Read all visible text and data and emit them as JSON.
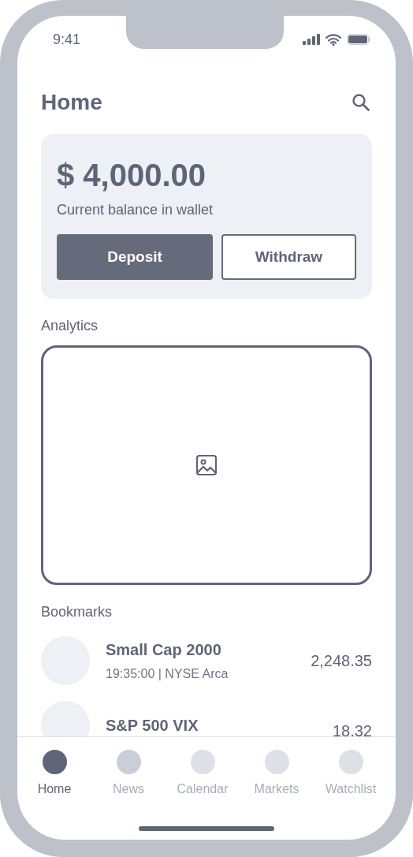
{
  "status_bar": {
    "time": "9:41"
  },
  "header": {
    "title": "Home"
  },
  "balance": {
    "amount": "$ 4,000.00",
    "caption": "Current balance in wallet",
    "buttons": [
      {
        "label": "Deposit",
        "kind": "primary"
      },
      {
        "label": "Withdraw",
        "kind": "secondary"
      }
    ]
  },
  "analytics": {
    "title": "Analytics"
  },
  "bookmarks": {
    "title": "Bookmarks",
    "items": [
      {
        "name": "Small Cap 2000",
        "detail": "19:35:00 | NYSE Arca",
        "value": "2,248.35"
      },
      {
        "name": "S&P 500 VIX",
        "value": "18.32"
      }
    ]
  },
  "tab_bar": [
    {
      "label": "Home",
      "selected": true,
      "color": "#5f6577"
    },
    {
      "label": "News",
      "selected": false,
      "color": "#c9ced9"
    },
    {
      "label": "Calendar",
      "selected": false,
      "color": "#dde0e6"
    },
    {
      "label": "Markets",
      "selected": false,
      "color": "#dde0e6"
    },
    {
      "label": "Watchlist",
      "selected": false,
      "color": "#dde0e6"
    }
  ]
}
